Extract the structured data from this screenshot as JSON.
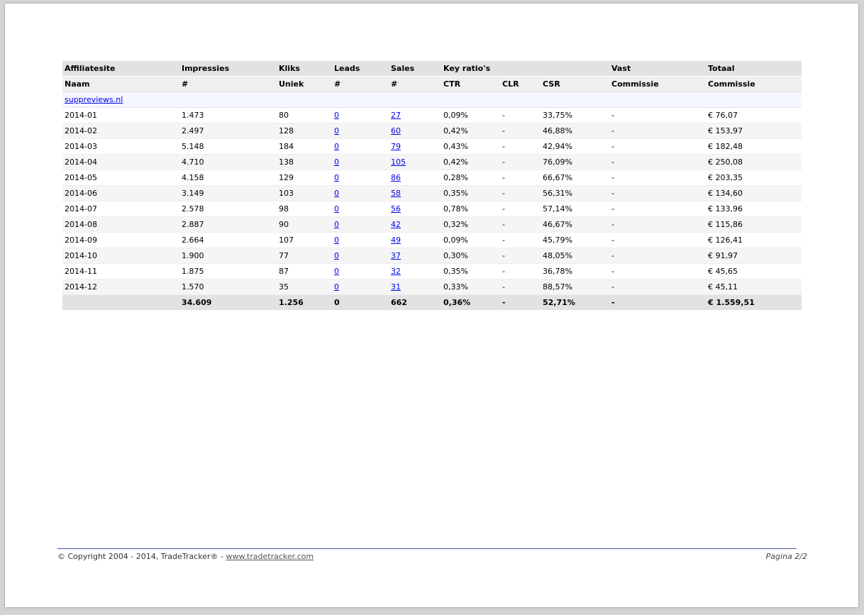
{
  "table": {
    "header1": [
      "Affiliatesite",
      "Impressies",
      "Kliks",
      "Leads",
      "Sales",
      "Key ratio's",
      "",
      "",
      "Vast",
      "Totaal"
    ],
    "header2": [
      "Naam",
      "#",
      "Uniek",
      "#",
      "#",
      "CTR",
      "CLR",
      "CSR",
      "Commissie",
      "Commissie"
    ],
    "site_name": "suppreviews.nl",
    "rows": [
      {
        "period": "2014-01",
        "impressions": "1.473",
        "clicks": "80",
        "leads": "0",
        "sales": "27",
        "ctr": "0,09%",
        "clr": "-",
        "csr": "33,75%",
        "fixed": "-",
        "total": "€ 76,07"
      },
      {
        "period": "2014-02",
        "impressions": "2.497",
        "clicks": "128",
        "leads": "0",
        "sales": "60",
        "ctr": "0,42%",
        "clr": "-",
        "csr": "46,88%",
        "fixed": "-",
        "total": "€ 153,97"
      },
      {
        "period": "2014-03",
        "impressions": "5.148",
        "clicks": "184",
        "leads": "0",
        "sales": "79",
        "ctr": "0,43%",
        "clr": "-",
        "csr": "42,94%",
        "fixed": "-",
        "total": "€ 182,48"
      },
      {
        "period": "2014-04",
        "impressions": "4.710",
        "clicks": "138",
        "leads": "0",
        "sales": "105",
        "ctr": "0,42%",
        "clr": "-",
        "csr": "76,09%",
        "fixed": "-",
        "total": "€ 250,08"
      },
      {
        "period": "2014-05",
        "impressions": "4.158",
        "clicks": "129",
        "leads": "0",
        "sales": "86",
        "ctr": "0,28%",
        "clr": "-",
        "csr": "66,67%",
        "fixed": "-",
        "total": "€ 203,35"
      },
      {
        "period": "2014-06",
        "impressions": "3.149",
        "clicks": "103",
        "leads": "0",
        "sales": "58",
        "ctr": "0,35%",
        "clr": "-",
        "csr": "56,31%",
        "fixed": "-",
        "total": "€ 134,60"
      },
      {
        "period": "2014-07",
        "impressions": "2.578",
        "clicks": "98",
        "leads": "0",
        "sales": "56",
        "ctr": "0,78%",
        "clr": "-",
        "csr": "57,14%",
        "fixed": "-",
        "total": "€ 133,96"
      },
      {
        "period": "2014-08",
        "impressions": "2.887",
        "clicks": "90",
        "leads": "0",
        "sales": "42",
        "ctr": "0,32%",
        "clr": "-",
        "csr": "46,67%",
        "fixed": "-",
        "total": "€ 115,86"
      },
      {
        "period": "2014-09",
        "impressions": "2.664",
        "clicks": "107",
        "leads": "0",
        "sales": "49",
        "ctr": "0,09%",
        "clr": "-",
        "csr": "45,79%",
        "fixed": "-",
        "total": "€ 126,41"
      },
      {
        "period": "2014-10",
        "impressions": "1.900",
        "clicks": "77",
        "leads": "0",
        "sales": "37",
        "ctr": "0,30%",
        "clr": "-",
        "csr": "48,05%",
        "fixed": "-",
        "total": "€ 91,97"
      },
      {
        "period": "2014-11",
        "impressions": "1.875",
        "clicks": "87",
        "leads": "0",
        "sales": "32",
        "ctr": "0,35%",
        "clr": "-",
        "csr": "36,78%",
        "fixed": "-",
        "total": "€ 45,65"
      },
      {
        "period": "2014-12",
        "impressions": "1.570",
        "clicks": "35",
        "leads": "0",
        "sales": "31",
        "ctr": "0,33%",
        "clr": "-",
        "csr": "88,57%",
        "fixed": "-",
        "total": "€ 45,11"
      }
    ],
    "totals": {
      "label": "",
      "impressions": "34.609",
      "clicks": "1.256",
      "leads": "0",
      "sales": "662",
      "ctr": "0,36%",
      "clr": "-",
      "csr": "52,71%",
      "fixed": "-",
      "total": "€ 1.559,51"
    }
  },
  "footer": {
    "copyright": "© Copyright 2004 - 2014, TradeTracker® - ",
    "link_text": "www.tradetracker.com",
    "page_label": "Pagina 2/2"
  },
  "colors": {
    "link": "#0000ee",
    "header_bg": "#e2e2e2",
    "footer_rule": "#4a57a6"
  }
}
